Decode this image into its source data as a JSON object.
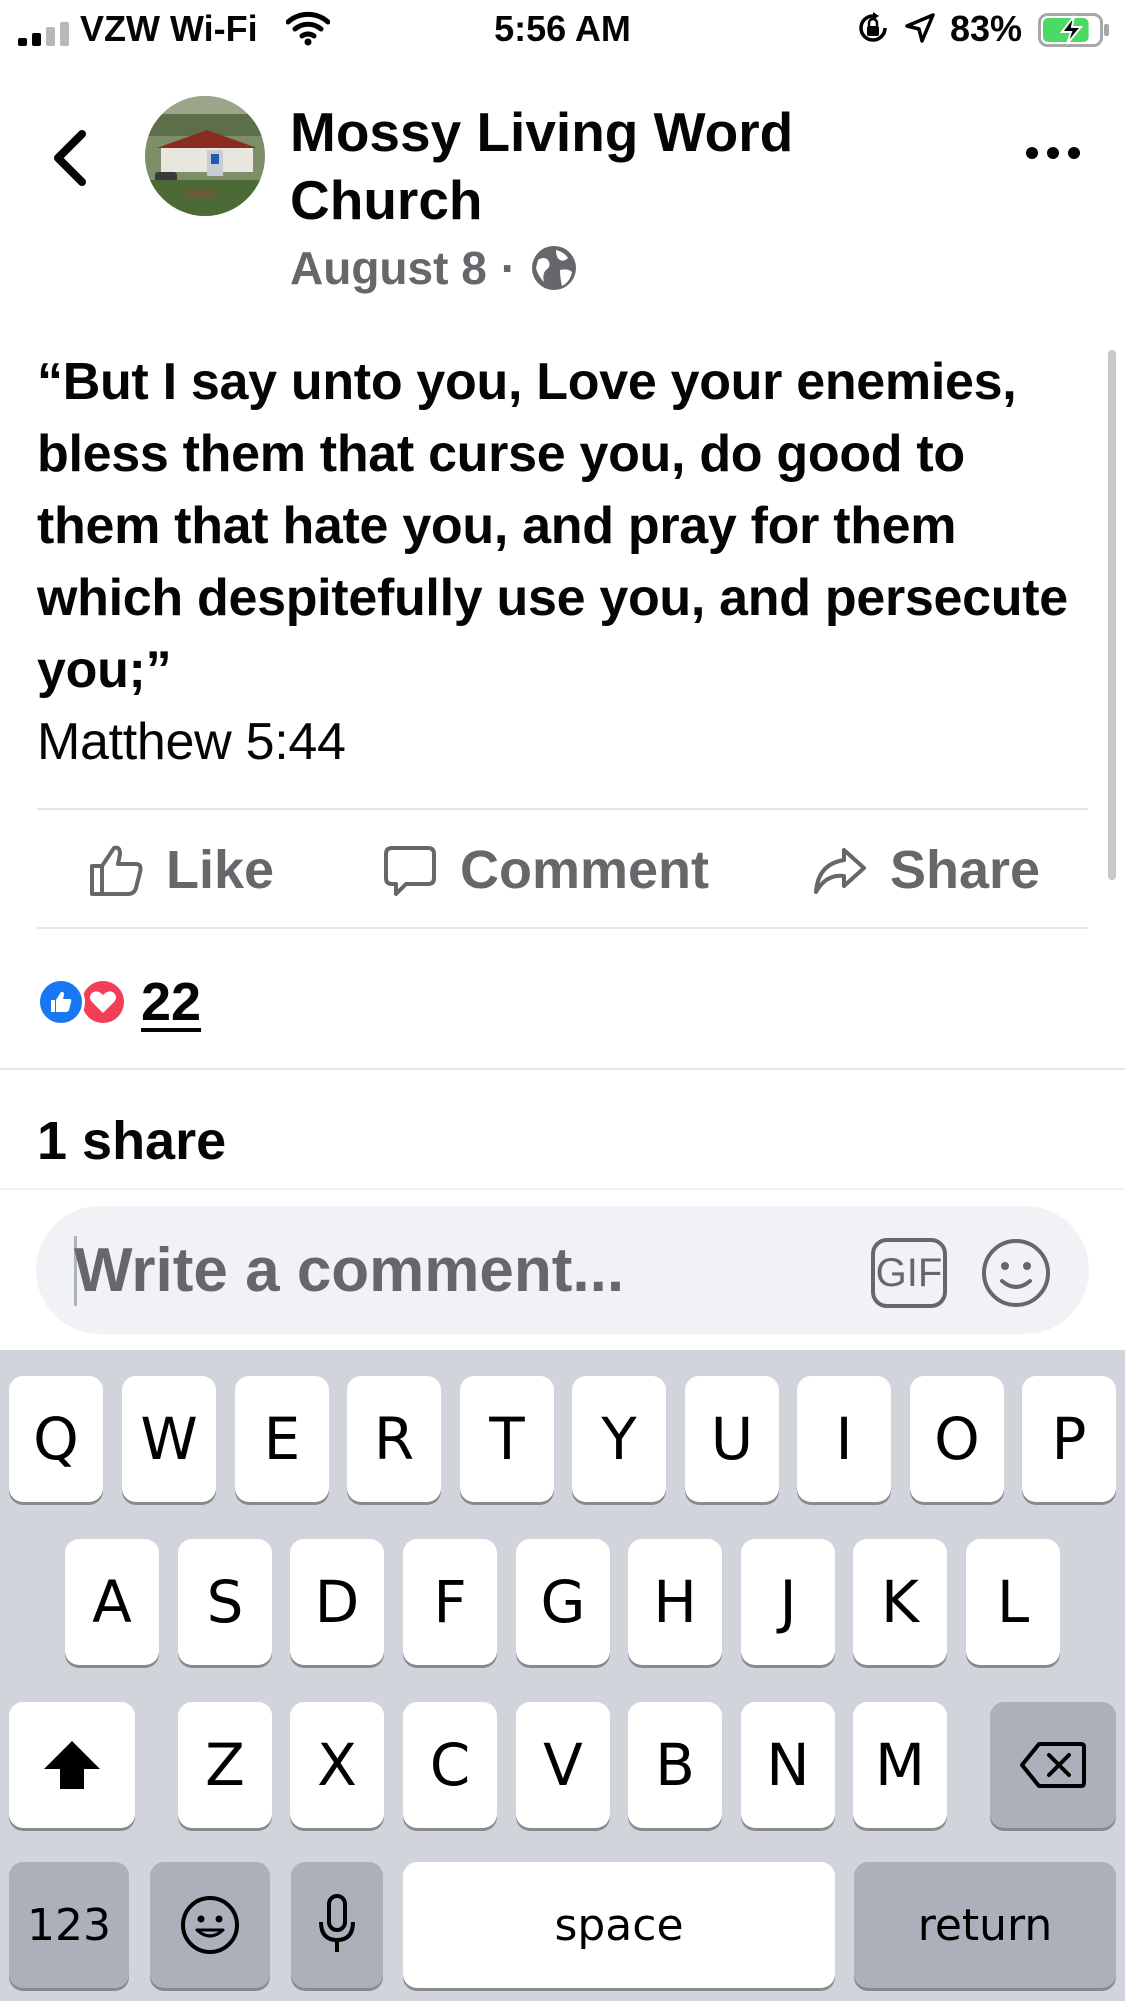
{
  "status_bar": {
    "carrier": "VZW Wi-Fi",
    "time": "5:56 AM",
    "battery_percent": "83%",
    "battery_level": 0.83,
    "icons": [
      "signal-icon",
      "wifi-icon",
      "rotation-lock-icon",
      "location-icon",
      "battery-charging-icon"
    ]
  },
  "post": {
    "page_name": "Mossy Living Word Church",
    "date": "August 8",
    "separator": "·",
    "audience_icon": "globe-icon",
    "text": "“But I say unto you, Love your enemies, bless them that curse you, do good to them that hate you, and pray for them which despitefully use you, and persecute you;”",
    "verse_ref": "Matthew 5:44"
  },
  "actions": {
    "like_label": "Like",
    "comment_label": "Comment",
    "share_label": "Share"
  },
  "engagement": {
    "reactions_count": "22",
    "reaction_icons": [
      "like-reaction-icon",
      "love-reaction-icon"
    ],
    "shares_label": "1 share"
  },
  "composer": {
    "placeholder": "Write a comment...",
    "gif_label": "GIF",
    "emoji_icon": "smiley-icon"
  },
  "keyboard": {
    "row1": [
      "Q",
      "W",
      "E",
      "R",
      "T",
      "Y",
      "U",
      "I",
      "O",
      "P"
    ],
    "row2": [
      "A",
      "S",
      "D",
      "F",
      "G",
      "H",
      "J",
      "K",
      "L"
    ],
    "row3": [
      "Z",
      "X",
      "C",
      "V",
      "B",
      "N",
      "M"
    ],
    "numbers_label": "123",
    "space_label": "space",
    "return_label": "return"
  },
  "colors": {
    "text_primary": "#050505",
    "text_secondary": "#65676b",
    "like_blue": "#1877f2",
    "love_red": "#f33e58",
    "keyboard_bg": "#d1d4db"
  }
}
